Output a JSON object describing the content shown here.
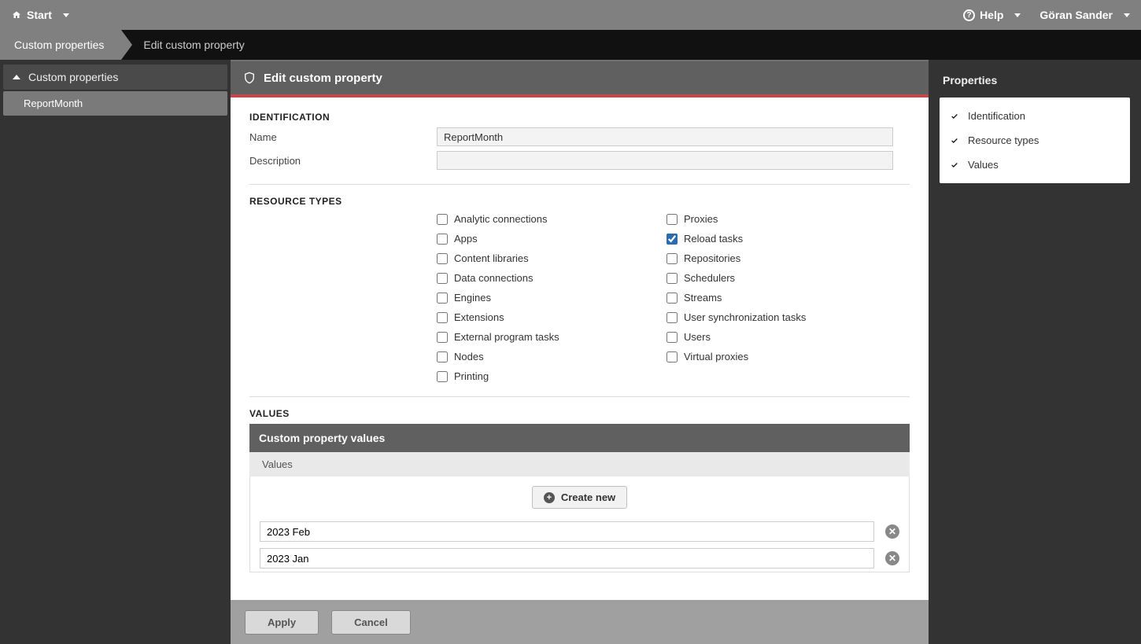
{
  "topbar": {
    "start": "Start",
    "help": "Help",
    "user": "Göran Sander"
  },
  "breadcrumb": {
    "item1": "Custom properties",
    "item2": "Edit custom property"
  },
  "leftnav": {
    "section": "Custom properties",
    "selected": "ReportMonth"
  },
  "header": {
    "title": "Edit custom property"
  },
  "identification": {
    "heading": "IDENTIFICATION",
    "name_label": "Name",
    "name_value": "ReportMonth",
    "desc_label": "Description",
    "desc_value": ""
  },
  "resource_types": {
    "heading": "RESOURCE TYPES",
    "left": [
      {
        "label": "Analytic connections",
        "checked": false
      },
      {
        "label": "Apps",
        "checked": false
      },
      {
        "label": "Content libraries",
        "checked": false
      },
      {
        "label": "Data connections",
        "checked": false
      },
      {
        "label": "Engines",
        "checked": false
      },
      {
        "label": "Extensions",
        "checked": false
      },
      {
        "label": "External program tasks",
        "checked": false
      },
      {
        "label": "Nodes",
        "checked": false
      },
      {
        "label": "Printing",
        "checked": false
      }
    ],
    "right": [
      {
        "label": "Proxies",
        "checked": false
      },
      {
        "label": "Reload tasks",
        "checked": true
      },
      {
        "label": "Repositories",
        "checked": false
      },
      {
        "label": "Schedulers",
        "checked": false
      },
      {
        "label": "Streams",
        "checked": false
      },
      {
        "label": "User synchronization tasks",
        "checked": false
      },
      {
        "label": "Users",
        "checked": false
      },
      {
        "label": "Virtual proxies",
        "checked": false
      }
    ]
  },
  "values": {
    "heading": "VALUES",
    "panel_title": "Custom property values",
    "col_label": "Values",
    "create_label": "Create new",
    "rows": [
      "2023 Feb",
      "2023 Jan"
    ]
  },
  "footer": {
    "apply": "Apply",
    "cancel": "Cancel"
  },
  "rightpanel": {
    "title": "Properties",
    "items": [
      "Identification",
      "Resource types",
      "Values"
    ]
  }
}
